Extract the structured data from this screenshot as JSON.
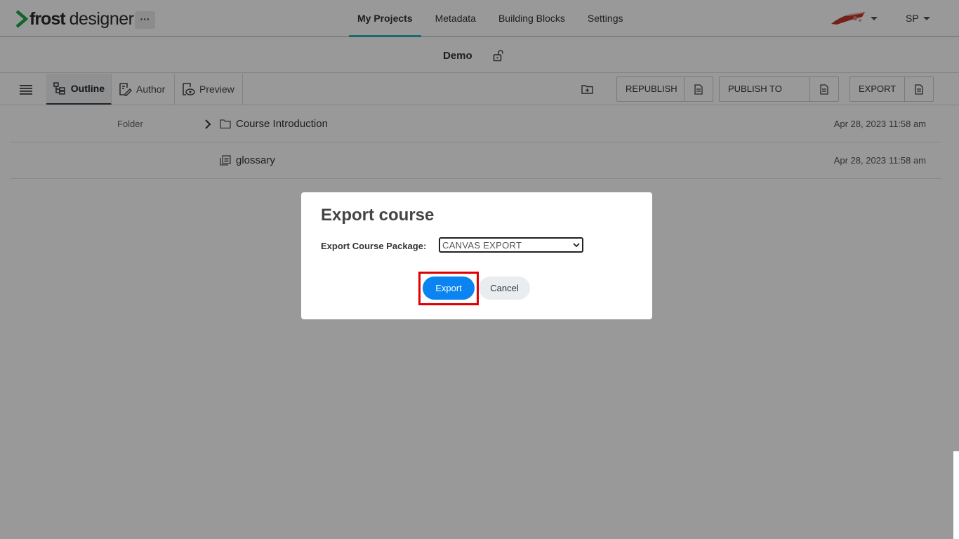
{
  "app": {
    "logo_bold": "frost",
    "logo_light": "designer",
    "more_label": "···"
  },
  "nav": {
    "tabs": [
      {
        "label": "My Projects",
        "active": true
      },
      {
        "label": "Metadata"
      },
      {
        "label": "Building Blocks"
      },
      {
        "label": "Settings"
      }
    ],
    "user_initials": "SP",
    "accent_color": "#2bb3b8"
  },
  "project": {
    "title": "Demo"
  },
  "toolbar": {
    "views": [
      {
        "label": "Outline",
        "active": true
      },
      {
        "label": "Author"
      },
      {
        "label": "Preview"
      }
    ],
    "republish_label": "REPUBLISH",
    "publish_lms_label": "PUBLISH TO LMS",
    "export_label": "EXPORT"
  },
  "items": [
    {
      "type": "Folder",
      "name": "Course Introduction",
      "date": "Apr 28, 2023 11:58 am",
      "icon": "folder-icon"
    },
    {
      "type": "",
      "name": "glossary",
      "date": "Apr 28, 2023 11:58 am",
      "icon": "page-icon"
    }
  ],
  "modal": {
    "title": "Export course",
    "package_label": "Export Course Package:",
    "package_selected": "CANVAS EXPORT",
    "export_button": "Export",
    "cancel_button": "Cancel",
    "primary_color": "#0a84f0",
    "highlight_color": "#e00000"
  }
}
